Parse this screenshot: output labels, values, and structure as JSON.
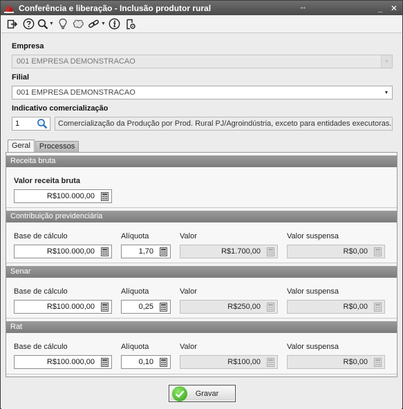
{
  "window": {
    "title": "Conferência e liberação - Inclusão produtor rural",
    "minimize": "_",
    "close": "✕"
  },
  "toolbar": {
    "icons": [
      "exit-icon",
      "help-icon",
      "search-icon",
      "lightbulb-icon",
      "shapes-icon",
      "link-icon",
      "info-icon",
      "document-settings-icon"
    ]
  },
  "empresa": {
    "label": "Empresa",
    "value": "001 EMPRESA DEMONSTRACAO"
  },
  "filial": {
    "label": "Filial",
    "value": "001 EMPRESA DEMONSTRACAO"
  },
  "indicativo": {
    "label": "Indicativo comercialização",
    "code": "1",
    "description": "Comercialização da Produção por Prod. Rural PJ/Agroindústria, exceto para entidades executoras..."
  },
  "tabs": [
    {
      "label": "Geral",
      "active": true
    },
    {
      "label": "Processos",
      "active": false
    }
  ],
  "receita_bruta": {
    "header": "Receita bruta",
    "label": "Valor receita bruta",
    "value": "R$100.000,00"
  },
  "columns": {
    "base": "Base de cálculo",
    "aliquota": "Alíquota",
    "valor": "Valor",
    "suspensa": "Valor suspensa"
  },
  "contribuicao": {
    "header": "Contribuição previdenciária",
    "base": "R$100.000,00",
    "aliquota": "1,70",
    "valor": "R$1.700,00",
    "suspensa": "R$0,00"
  },
  "senar": {
    "header": "Senar",
    "base": "R$100.000,00",
    "aliquota": "0,25",
    "valor": "R$250,00",
    "suspensa": "R$0,00"
  },
  "rat": {
    "header": "Rat",
    "base": "R$100.000,00",
    "aliquota": "0,10",
    "valor": "R$100,00",
    "suspensa": "R$0,00"
  },
  "footer": {
    "save_label": "Gravar"
  },
  "colors": {
    "titlebar": "#555555",
    "section_header": "#8a8a8a",
    "save_check": "#3aa81c"
  }
}
